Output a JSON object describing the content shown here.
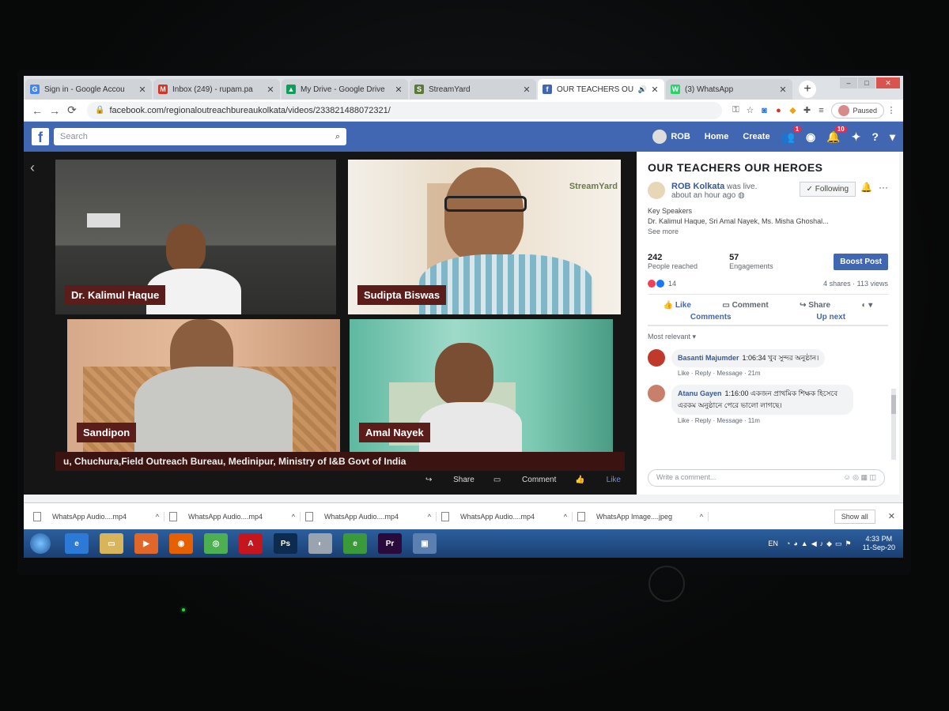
{
  "tabs": [
    {
      "title": "Sign in - Google Accou",
      "icon": "google-icon",
      "color": "#4285f4",
      "letter": "G",
      "active": false
    },
    {
      "title": "Inbox (249) - rupam.pa",
      "icon": "gmail-icon",
      "color": "#d93025",
      "letter": "M",
      "active": false
    },
    {
      "title": "My Drive - Google Drive",
      "icon": "drive-icon",
      "color": "#0f9d58",
      "letter": "▲",
      "active": false
    },
    {
      "title": "StreamYard",
      "icon": "streamyard-icon",
      "color": "#5b7a3a",
      "letter": "S",
      "active": false
    },
    {
      "title": "OUR TEACHERS OU",
      "icon": "facebook-icon",
      "color": "#4267b2",
      "letter": "f",
      "active": true
    },
    {
      "title": "(3) WhatsApp",
      "icon": "whatsapp-icon",
      "color": "#25d366",
      "letter": "W",
      "active": false
    }
  ],
  "address": {
    "url": "facebook.com/regionaloutreachbureaukolkata/videos/233821488072321/",
    "profile_status": "Paused"
  },
  "fb_bar": {
    "search_placeholder": "Search",
    "profile_name": "ROB",
    "home": "Home",
    "create": "Create",
    "friend_badge": "1",
    "notif_badge": "10"
  },
  "video": {
    "participants": [
      {
        "name": "Dr. Kalimul Haque"
      },
      {
        "name": "Sudipta Biswas"
      },
      {
        "name": "Sandipon"
      },
      {
        "name": "Amal Nayek"
      }
    ],
    "watermark": "StreamYard",
    "ticker": "u, Chuchura,Field Outreach Bureau, Medinipur, Ministry of I&B Govt of India",
    "actions": {
      "share": "Share",
      "comment": "Comment",
      "like": "Like"
    }
  },
  "post": {
    "title": "OUR TEACHERS OUR HEROES",
    "page_name": "ROB Kolkata",
    "status": "was live.",
    "time": "about an hour ago",
    "following": "Following",
    "desc_line1": "Key Speakers",
    "desc_line2": "Dr. Kalimul Haque, Sri Amal Nayek, Ms. Misha Ghoshal...",
    "see_more": "See more",
    "reached_value": "242",
    "reached_label": "People reached",
    "engagements_value": "57",
    "engagements_label": "Engagements",
    "boost": "Boost Post",
    "reaction_count": "14",
    "shares_views": "4 shares · 113 views",
    "like": "Like",
    "comment": "Comment",
    "share": "Share",
    "comments_tab": "Comments",
    "upnext_tab": "Up next",
    "sort": "Most relevant ▾",
    "comments": [
      {
        "author": "Basanti Majumder",
        "text": "1:06:34 খুব সুন্দর অনুষ্ঠান।",
        "meta": "Like · Reply · Message · 21m",
        "avatar_color": "#c0392b"
      },
      {
        "author": "Atanu Gayen",
        "text": "1:16:00 একজন প্রাথমিক শিক্ষক হিসেবে এরকম অনুষ্ঠানে পেরে ভালো লাগছে।",
        "meta": "Like · Reply · Message · 11m",
        "avatar_color": "#c9806a"
      }
    ],
    "write_comment": "Write a comment..."
  },
  "downloads": {
    "items": [
      {
        "name": "WhatsApp Audio....mp4"
      },
      {
        "name": "WhatsApp Audio....mp4"
      },
      {
        "name": "WhatsApp Audio....mp4"
      },
      {
        "name": "WhatsApp Audio....mp4"
      },
      {
        "name": "WhatsApp Image....jpeg"
      }
    ],
    "show_all": "Show all"
  },
  "taskbar": {
    "apps": [
      {
        "icon": "ie-icon",
        "color": "#2b7bd6",
        "label": "e"
      },
      {
        "icon": "explorer-icon",
        "color": "#d8b45a",
        "label": "▭"
      },
      {
        "icon": "media-player-icon",
        "color": "#e0662a",
        "label": "▶"
      },
      {
        "icon": "firefox-icon",
        "color": "#e66000",
        "label": "◉"
      },
      {
        "icon": "chrome-icon",
        "color": "#4caf50",
        "label": "◎"
      },
      {
        "icon": "acrobat-icon",
        "color": "#c4161c",
        "label": "A"
      },
      {
        "icon": "photoshop-icon",
        "color": "#0d2b4e",
        "label": "Ps"
      },
      {
        "icon": "mouse-app-icon",
        "color": "#9aa4b0",
        "label": "◐"
      },
      {
        "icon": "ie-green-icon",
        "color": "#3a9a3a",
        "label": "e"
      },
      {
        "icon": "premiere-icon",
        "color": "#2a0a3a",
        "label": "Pr"
      },
      {
        "icon": "media-center-icon",
        "color": "#5b7fb0",
        "label": "▣"
      }
    ],
    "lang": "EN",
    "time": "4:33 PM",
    "date": "11-Sep-20"
  }
}
